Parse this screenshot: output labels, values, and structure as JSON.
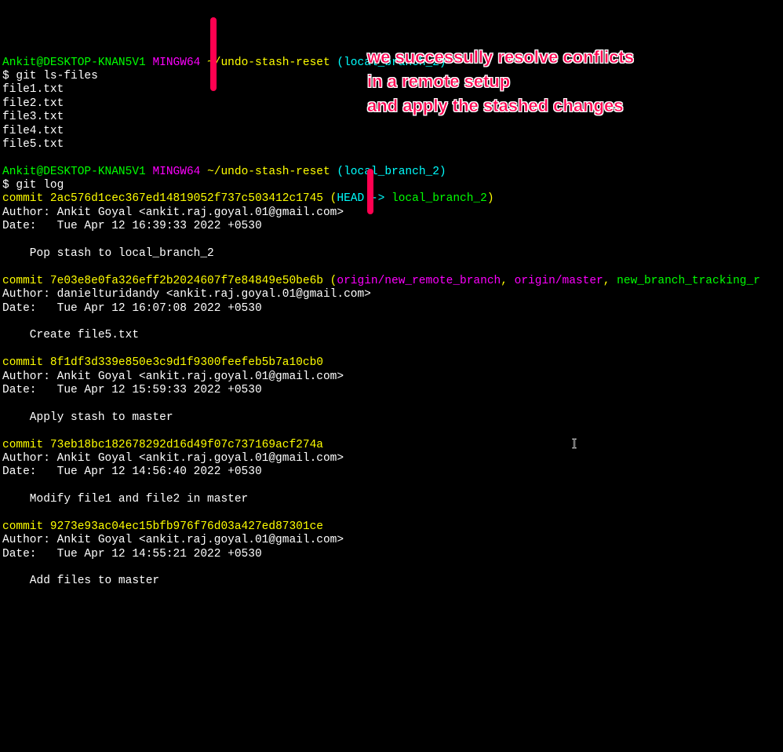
{
  "prompt1": {
    "user_host": "Ankit@DESKTOP-KNAN5V1",
    "env": "MINGW64",
    "path": "~/undo-stash-reset",
    "branch": "(local_branch_2)"
  },
  "cmd1": "$ git ls-files",
  "files": [
    "file1.txt",
    "file2.txt",
    "file3.txt",
    "file4.txt",
    "file5.txt"
  ],
  "blank1": "",
  "prompt2": {
    "user_host": "Ankit@DESKTOP-KNAN5V1",
    "env": "MINGW64",
    "path": "~/undo-stash-reset",
    "branch": "(local_branch_2)"
  },
  "cmd2": "$ git log",
  "commits": [
    {
      "hash_prefix": "commit ",
      "hash": "2ac576d1cec367ed14819052f737c503412c1745",
      "refs_open": " (",
      "head": "HEAD -> ",
      "head_branch": "local_branch_2",
      "refs_other": "",
      "refs_close": ")",
      "author": "Author: Ankit Goyal <ankit.raj.goyal.01@gmail.com>",
      "date": "Date:   Tue Apr 12 16:39:33 2022 +0530",
      "blank_a": "",
      "msg": "    Pop stash to local_branch_2",
      "blank_b": ""
    },
    {
      "hash_prefix": "commit ",
      "hash": "7e03e8e0fa326eff2b2024607f7e84849e50be6b",
      "refs_open": " (",
      "ref1": "origin/new_remote_branch",
      "sep1": ", ",
      "ref2": "origin/master",
      "sep2": ", ",
      "ref3": "new_branch_tracking_r",
      "refs_close": "",
      "author": "Author: danielturidandy <ankit.raj.goyal.01@gmail.com>",
      "date": "Date:   Tue Apr 12 16:07:08 2022 +0530",
      "blank_a": "",
      "msg": "    Create file5.txt",
      "blank_b": ""
    },
    {
      "hash_prefix": "commit ",
      "hash": "8f1df3d339e850e3c9d1f9300feefeb5b7a10cb0",
      "author": "Author: Ankit Goyal <ankit.raj.goyal.01@gmail.com>",
      "date": "Date:   Tue Apr 12 15:59:33 2022 +0530",
      "blank_a": "",
      "msg": "    Apply stash to master",
      "blank_b": ""
    },
    {
      "hash_prefix": "commit ",
      "hash": "73eb18bc182678292d16d49f07c737169acf274a",
      "author": "Author: Ankit Goyal <ankit.raj.goyal.01@gmail.com>",
      "date": "Date:   Tue Apr 12 14:56:40 2022 +0530",
      "blank_a": "",
      "msg": "    Modify file1 and file2 in master",
      "blank_b": ""
    },
    {
      "hash_prefix": "commit ",
      "hash": "9273e93ac04ec15bfb976f76d03a427ed87301ce",
      "author": "Author: Ankit Goyal <ankit.raj.goyal.01@gmail.com>",
      "date": "Date:   Tue Apr 12 14:55:21 2022 +0530",
      "blank_a": "",
      "msg": "    Add files to master"
    }
  ],
  "annotation": {
    "line1": "we successully resolve conflicts",
    "line2": "in a remote setup",
    "line3": "and apply the stashed changes"
  },
  "colors": {
    "bar": "#ff0050"
  }
}
